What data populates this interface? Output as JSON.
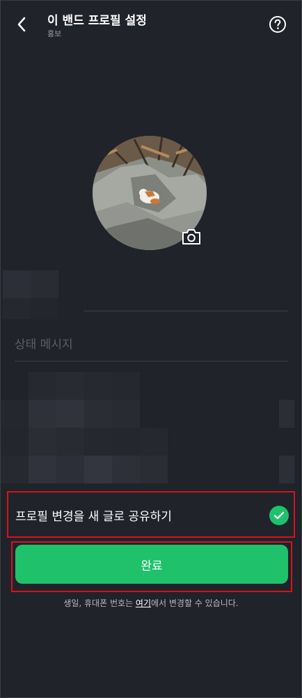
{
  "header": {
    "title": "이 밴드 프로필 설정",
    "subtitle": "홍보",
    "back_icon": "chevron-left-icon",
    "help_icon": "question-circle-icon"
  },
  "profile": {
    "camera_icon": "camera-icon"
  },
  "status_message": {
    "placeholder": "상태 메시지"
  },
  "share": {
    "label": "프로필 변경을 새 글로 공유하기",
    "checked": true,
    "check_icon": "check-icon"
  },
  "done_button": {
    "label": "완료"
  },
  "info": {
    "prefix": "생일, 휴대폰 번호는 ",
    "link": "여기",
    "suffix": "에서 변경할 수 있습니다."
  },
  "colors": {
    "background": "#20232a",
    "accent_green": "#1fc26b",
    "highlight_red": "#d4141c"
  }
}
